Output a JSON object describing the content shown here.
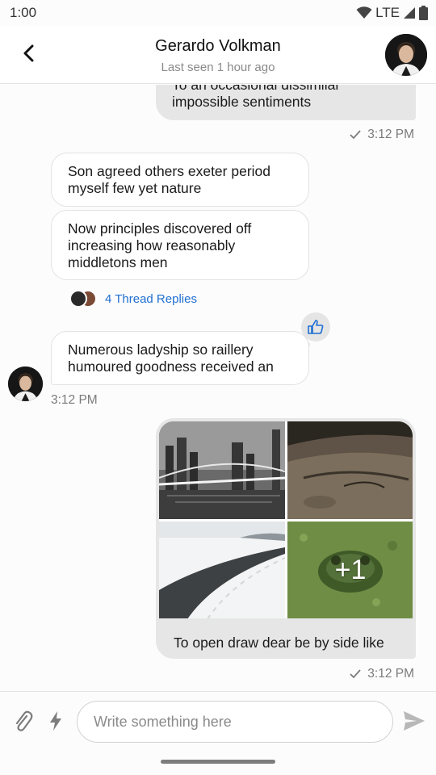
{
  "status_bar": {
    "time": "1:00",
    "network": "LTE"
  },
  "header": {
    "name": "Gerardo Volkman",
    "last_seen": "Last seen 1 hour ago",
    "avatar_icon": "user-avatar"
  },
  "messages": [
    {
      "direction": "outgoing",
      "text": "To an occasional dissimilar impossible sentiments",
      "time": "3:12 PM",
      "status": "sent"
    },
    {
      "direction": "incoming",
      "text": "Son agreed others exeter period myself few yet nature"
    },
    {
      "direction": "incoming",
      "text": "Now principles discovered off increasing how reasonably middletons men",
      "thread_replies": "4 Thread Replies"
    },
    {
      "direction": "incoming",
      "text": "Numerous ladyship so raillery humoured goodness received an",
      "time": "3:12 PM",
      "reaction_icon": "thumbs-up-icon"
    },
    {
      "direction": "outgoing",
      "images": [
        "city-bridge-night",
        "rusty-car",
        "snowy-road",
        "frog-in-duckweed"
      ],
      "more_count": "+1",
      "text": "To open draw dear be by side like",
      "time": "3:12 PM",
      "status": "sent"
    }
  ],
  "composer": {
    "placeholder": "Write something here",
    "value": ""
  },
  "colors": {
    "outgoing_bubble": "#e6e6e6",
    "incoming_bubble": "#ffffff",
    "link": "#1f6fd1",
    "reaction_icon": "#1f6fd1"
  }
}
